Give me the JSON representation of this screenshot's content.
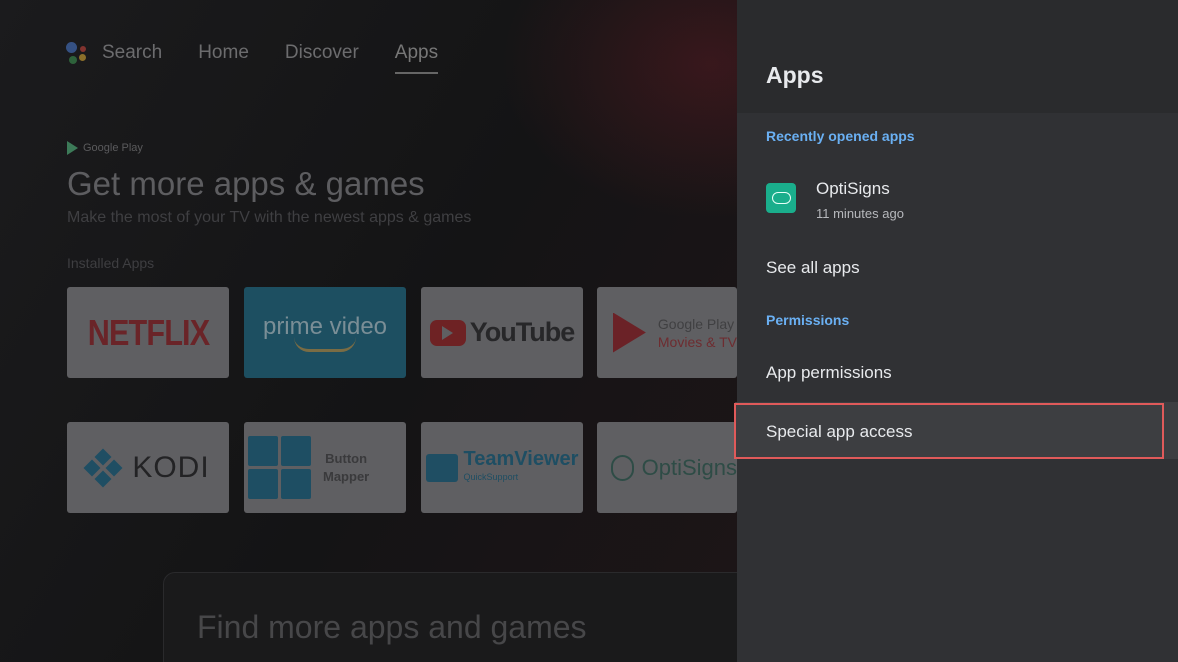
{
  "launcher": {
    "nav": {
      "search": "Search",
      "home": "Home",
      "discover": "Discover",
      "apps": "Apps"
    },
    "promo": {
      "store": "Google Play",
      "title": "Get more apps & games",
      "subtitle": "Make the most of your TV with the newest apps & games"
    },
    "installed_label": "Installed Apps",
    "tiles": {
      "netflix": "NETFLIX",
      "prime": "prime video",
      "youtube": "YouTube",
      "gpm_line1": "Google Play",
      "gpm_line2": "Movies & TV",
      "kodi": "KODI",
      "button_mapper_line1": "Button",
      "button_mapper_line2": "Mapper",
      "teamviewer": "TeamViewer",
      "teamviewer_sub": "QuickSupport",
      "optisigns": "OptiSigns"
    },
    "find_more": "Find more apps and games"
  },
  "panel": {
    "title": "Apps",
    "recent_label": "Recently opened apps",
    "recent_app": {
      "name": "OptiSigns",
      "time": "11 minutes ago",
      "icon": "cloud-icon",
      "icon_color": "#1aae8c"
    },
    "see_all": "See all apps",
    "permissions_label": "Permissions",
    "app_permissions": "App permissions",
    "special_access": "Special app access"
  },
  "colors": {
    "accent": "#6ab0f3",
    "highlight": "#e05a5a"
  }
}
